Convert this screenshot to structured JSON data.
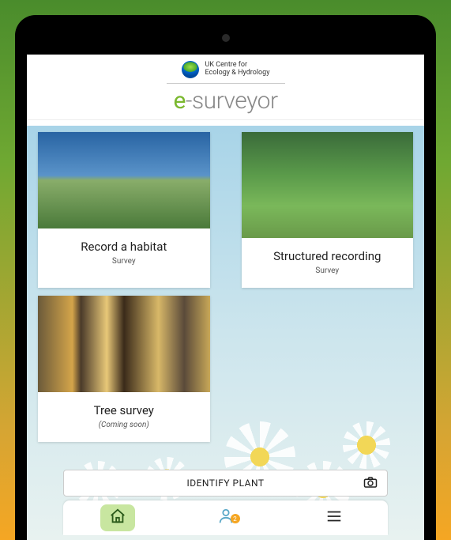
{
  "header": {
    "org_line1": "UK Centre for",
    "org_line2": "Ecology & Hydrology",
    "brand_prefix": "e",
    "brand_rest": "-surveyor"
  },
  "cards": [
    {
      "title": "Record a habitat",
      "subtitle": "Survey",
      "italic": false
    },
    {
      "title": "Structured recording",
      "subtitle": "Survey",
      "italic": false
    },
    {
      "title": "Tree survey",
      "subtitle": "(Coming soon)",
      "italic": true
    }
  ],
  "identify_label": "IDENTIFY PLANT",
  "nav": {
    "badge_count": "2"
  }
}
